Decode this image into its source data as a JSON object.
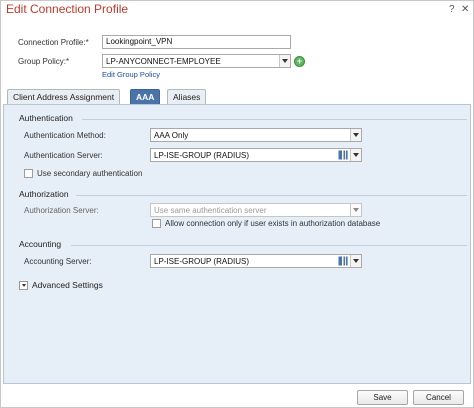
{
  "dialog": {
    "title": "Edit Connection Profile",
    "help_glyph": "?",
    "close_glyph": "✕"
  },
  "profile": {
    "connection_label": "Connection Profile:*",
    "connection_value": "Lookingpoint_VPN",
    "group_policy_label": "Group Policy:*",
    "group_policy_value": "LP-ANYCONNECT-EMPLOYEE",
    "edit_group_policy_link": "Edit Group Policy",
    "add_glyph": "+"
  },
  "tabs": [
    {
      "label": "Client Address Assignment",
      "active": false
    },
    {
      "label": "AAA",
      "active": true
    },
    {
      "label": "Aliases",
      "active": false
    }
  ],
  "authentication": {
    "section_title": "Authentication",
    "method_label": "Authentication Method:",
    "method_value": "AAA Only",
    "server_label": "Authentication Server:",
    "server_value": "LP-ISE-GROUP (RADIUS)",
    "secondary_label": "Use secondary authentication",
    "secondary_checked": false
  },
  "authorization": {
    "section_title": "Authorization",
    "server_label": "Authorization Server:",
    "server_placeholder": "Use same authentication server",
    "allow_label": "Allow connection only if user exists in authorization database",
    "allow_checked": false
  },
  "accounting": {
    "section_title": "Accounting",
    "server_label": "Accounting Server:",
    "server_value": "LP-ISE-GROUP (RADIUS)"
  },
  "advanced": {
    "label": "Advanced Settings"
  },
  "footer": {
    "save_label": "Save",
    "cancel_label": "Cancel"
  },
  "colors": {
    "title": "#c0392b",
    "active_tab": "#4a73a8",
    "panel_bg": "#e6eef8",
    "link": "#1a4fa0",
    "add_icon": "#5cb85c"
  }
}
